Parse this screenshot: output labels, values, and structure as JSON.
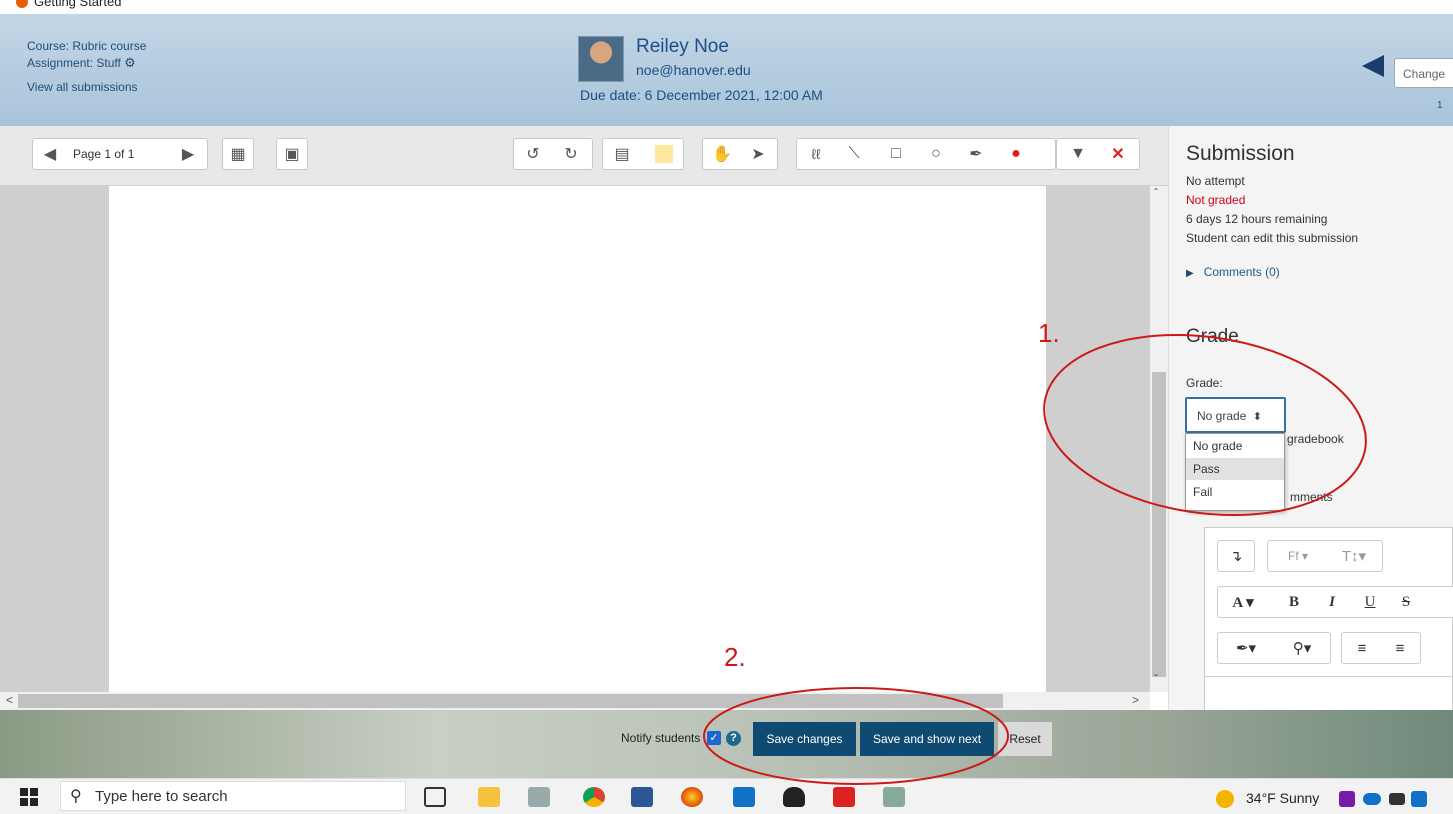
{
  "browser": {
    "tab_title": "Getting Started"
  },
  "header": {
    "course": "Course: Rubric course",
    "assignment": "Assignment: Stuff",
    "view_all": "View all submissions",
    "user_name": "Reiley Noe",
    "user_email": "noe@hanover.edu",
    "due_date": "Due date: 6 December 2021, 12:00 AM",
    "change_user_placeholder": "Change",
    "page_count": "1"
  },
  "toolbar": {
    "page_label": "Page 1 of 1"
  },
  "submission": {
    "title": "Submission",
    "status": "No attempt",
    "grading_status": "Not graded",
    "time_remaining": "6 days 12 hours remaining",
    "edit_status": "Student can edit this submission",
    "comments": "Comments (0)",
    "not_graded_color": "#d0021b"
  },
  "grade": {
    "title": "Grade",
    "label": "Grade:",
    "selected": "No grade",
    "options": [
      "No grade",
      "Pass",
      "Fail"
    ],
    "gradebook_suffix": "gradebook",
    "feedback_suffix": "mments"
  },
  "actions": {
    "notify_label": "Notify students",
    "save_changes": "Save changes",
    "save_and_show_next": "Save and show next",
    "reset": "Reset"
  },
  "annotations": {
    "one": "1.",
    "two": "2."
  },
  "taskbar": {
    "search_placeholder": "Type here to search",
    "weather": "34°F  Sunny"
  },
  "colors": {
    "header_blue": "#b4cce0",
    "primary_button": "#0f4a73",
    "annotation_red": "#cc1a1a"
  }
}
